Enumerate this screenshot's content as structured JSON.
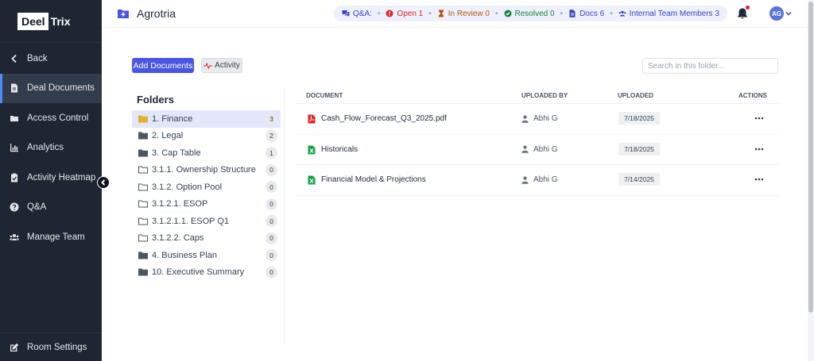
{
  "brand": {
    "part1": "Deel",
    "part2": "Trix"
  },
  "sidebar": {
    "back_label": "Back",
    "items": [
      {
        "label": "Deal Documents",
        "icon": "document-icon"
      },
      {
        "label": "Access Control",
        "icon": "key-icon"
      },
      {
        "label": "Analytics",
        "icon": "chart-icon"
      },
      {
        "label": "Activity Heatmap",
        "icon": "clipboard-icon"
      },
      {
        "label": "Q&A",
        "icon": "question-icon"
      },
      {
        "label": "Manage Team",
        "icon": "users-icon"
      }
    ],
    "settings_label": "Room Settings"
  },
  "header": {
    "room_title": "Agrotria",
    "stats": {
      "qa_label": "Q&A:",
      "open": "Open 1",
      "in_review": "In Review 0",
      "resolved": "Resolved 0",
      "docs": "Docs 6",
      "team": "Internal Team Members 3"
    },
    "avatar_initials": "AG"
  },
  "toolbar": {
    "add_label": "Add Documents",
    "activity_label": "Activity",
    "search_placeholder": "Search in this folder..."
  },
  "folders": {
    "title": "Folders",
    "items": [
      {
        "name": "1. Finance",
        "count": "3"
      },
      {
        "name": "2. Legal",
        "count": "2"
      },
      {
        "name": "3. Cap Table",
        "count": "1"
      },
      {
        "name": "3.1.1. Ownership Structure",
        "count": "0"
      },
      {
        "name": "3.1.2. Option Pool",
        "count": "0"
      },
      {
        "name": "3.1.2.1. ESOP",
        "count": "0"
      },
      {
        "name": "3.1.2.1.1. ESOP Q1",
        "count": "0"
      },
      {
        "name": "3.1.2.2. Caps",
        "count": "0"
      },
      {
        "name": "4. Business Plan",
        "count": "0"
      },
      {
        "name": "10. Executive Summary",
        "count": "0"
      }
    ]
  },
  "documents": {
    "columns": {
      "document": "DOCUMENT",
      "uploaded_by": "UPLOADED BY",
      "uploaded": "UPLOADED",
      "actions": "ACTIONS"
    },
    "rows": [
      {
        "name": "Cash_Flow_Forecast_Q3_2025.pdf",
        "type": "pdf",
        "uploader": "Abhi G",
        "date": "7/18/2025"
      },
      {
        "name": "Historicals",
        "type": "excel",
        "uploader": "Abhi G",
        "date": "7/18/2025"
      },
      {
        "name": "Financial Model & Projections",
        "type": "excel",
        "uploader": "Abhi G",
        "date": "7/14/2025"
      }
    ]
  },
  "colors": {
    "sidebar_bg": "#1e2633",
    "accent": "#4a56e2",
    "open": "#dc2626",
    "in_review": "#b45309",
    "resolved": "#15803d",
    "docs": "#3b3fc4",
    "folder_active": "#e3b12a",
    "pdf": "#dc2626",
    "excel": "#16a34a"
  }
}
